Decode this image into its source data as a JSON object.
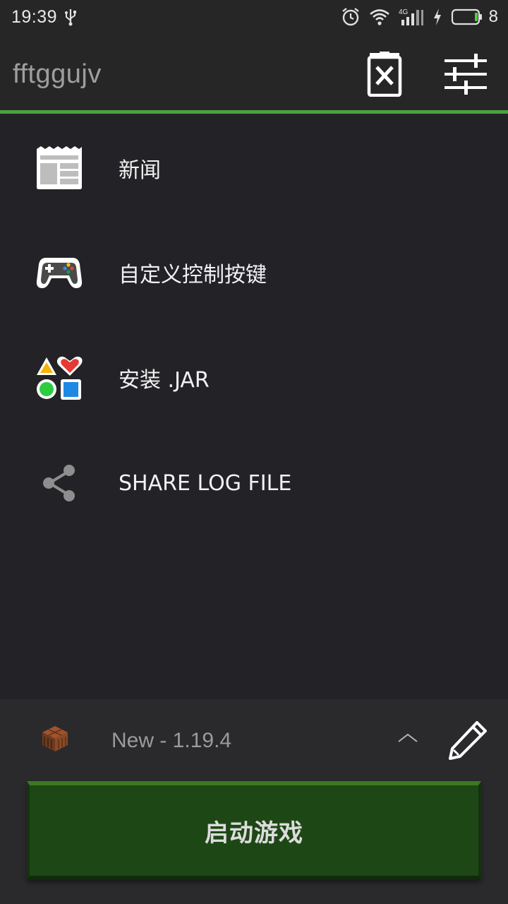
{
  "status_bar": {
    "time": "19:39",
    "battery_level": "8",
    "network": "4G"
  },
  "toolbar": {
    "title": "fftggujv"
  },
  "menu": {
    "items": [
      {
        "label": "新闻",
        "icon": "news-icon"
      },
      {
        "label": "自定义控制按键",
        "icon": "gamepad-icon"
      },
      {
        "label": "安装 .JAR",
        "icon": "shapes-icon"
      },
      {
        "label": "SHARE LOG FILE",
        "icon": "share-icon"
      }
    ]
  },
  "profile": {
    "name": "New - 1.19.4"
  },
  "launch": {
    "label": "启动游戏"
  },
  "colors": {
    "background": "#232227",
    "accent": "#4aa13e",
    "launch_button": "#1e4716"
  }
}
